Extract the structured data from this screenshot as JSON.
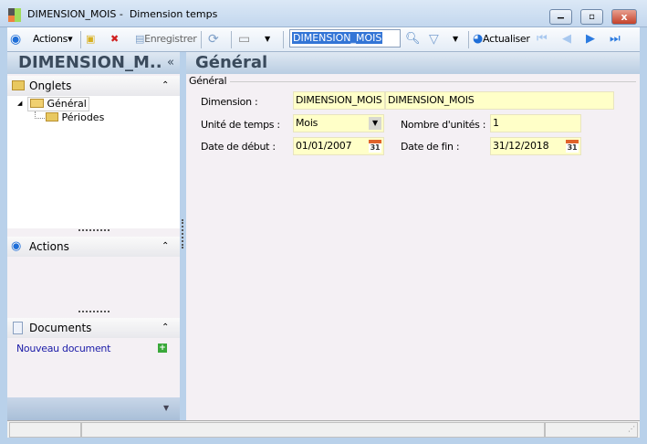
{
  "window": {
    "title": "DIMENSION_MOIS -  Dimension temps"
  },
  "toolbar": {
    "actions": "Actions",
    "save": "Enregistrer",
    "search_value": "DIMENSION_MOIS",
    "refresh": "Actualiser"
  },
  "left_header": "DIMENSION_M..",
  "right_header": "Général",
  "sidebar": {
    "onglets": {
      "title": "Onglets",
      "items": [
        "Général",
        "Périodes"
      ]
    },
    "actions": {
      "title": "Actions"
    },
    "documents": {
      "title": "Documents",
      "new_doc": "Nouveau document"
    }
  },
  "form": {
    "group": "Général",
    "dimension_label": "Dimension :",
    "dimension_code": "DIMENSION_MOIS",
    "dimension_name": "DIMENSION_MOIS",
    "unit_label": "Unité de temps :",
    "unit_value": "Mois",
    "count_label": "Nombre d'unités :",
    "count_value": "1",
    "start_label": "Date de début :",
    "start_value": "01/01/2007",
    "end_label": "Date de fin :",
    "end_value": "31/12/2018",
    "cal_text": "31"
  },
  "colors": {
    "field_bg": "#ffffc8",
    "accent": "#1e6ed8",
    "link": "#1c1ca8"
  }
}
